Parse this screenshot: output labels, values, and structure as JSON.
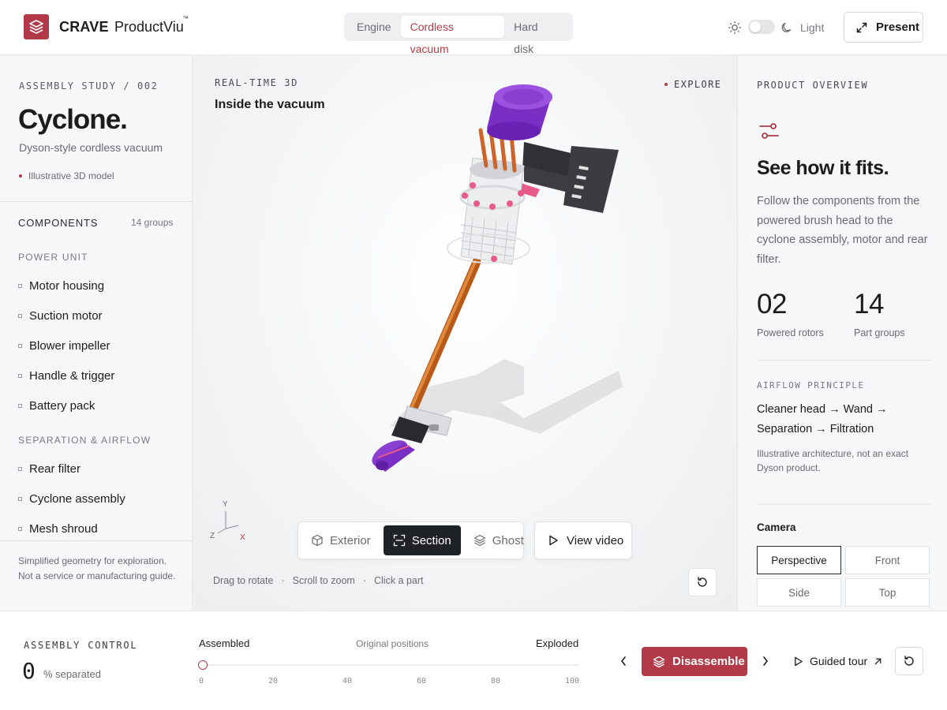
{
  "header": {
    "brand": "CRAVE",
    "product": "ProductViu",
    "trademark": "™",
    "tabs": [
      "Engine",
      "Cordless vacuum",
      "Hard disk"
    ],
    "active_tab": "Cordless vacuum",
    "theme_label": "Light",
    "present_label": "Present"
  },
  "sidebar": {
    "eyebrow": "ASSEMBLY STUDY / 002",
    "title": "Cyclone.",
    "subtitle": "Dyson-style cordless vacuum",
    "note": "Illustrative 3D model",
    "components_label": "COMPONENTS",
    "components_count": "14 groups",
    "groups": [
      {
        "name": "POWER UNIT",
        "items": [
          "Motor housing",
          "Suction motor",
          "Blower impeller",
          "Handle & trigger",
          "Battery pack"
        ]
      },
      {
        "name": "SEPARATION & AIRFLOW",
        "items": [
          "Rear filter",
          "Cyclone assembly",
          "Mesh shroud"
        ]
      }
    ],
    "footer": "Simplified geometry for exploration. Not a service or manufacturing guide."
  },
  "viewport": {
    "eyebrow": "REAL-TIME 3D",
    "title": "Inside the vacuum",
    "explore_label": "EXPLORE",
    "axes": {
      "y": "Y",
      "z": "Z",
      "x": "X"
    },
    "modes": [
      "Exterior",
      "Section",
      "Ghost"
    ],
    "active_mode": "Section",
    "video_label": "View video",
    "hints": [
      "Drag to rotate",
      "·",
      "Scroll to zoom",
      "·",
      "Click a part"
    ]
  },
  "overview": {
    "eyebrow": "PRODUCT OVERVIEW",
    "title": "See how it fits.",
    "body": "Follow the components from the powered brush head to the cyclone assembly, motor and rear filter.",
    "stats": [
      {
        "value": "02",
        "label": "Powered rotors"
      },
      {
        "value": "14",
        "label": "Part groups"
      }
    ],
    "airflow_label": "AIRFLOW PRINCIPLE",
    "airflow_text": "Cleaner head → Wand → Separation → Filtration",
    "airflow_note": "Illustrative architecture, not an exact Dyson product.",
    "camera_label": "Camera",
    "camera_options": [
      "Perspective",
      "Front",
      "Side",
      "Top"
    ],
    "active_camera": "Perspective"
  },
  "assembly": {
    "eyebrow": "ASSEMBLY CONTROL",
    "value": "0",
    "unit": "% separated",
    "label_start": "Assembled",
    "label_mid": "Original positions",
    "label_end": "Exploded",
    "ticks": [
      "0",
      "20",
      "40",
      "60",
      "80",
      "100"
    ],
    "separation_percent": 0,
    "primary_label": "Disassemble",
    "tour_label": "Guided tour"
  },
  "colors": {
    "accent": "#b23a48",
    "dark": "#1f2326",
    "purple": "#8a3fd1",
    "wand": "#c8691e"
  }
}
